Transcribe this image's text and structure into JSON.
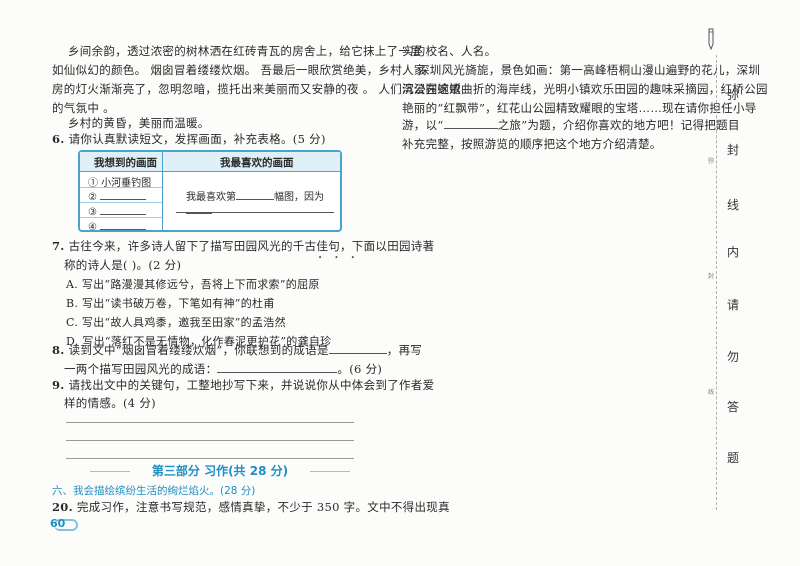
{
  "left": {
    "para1": [
      "乡间余韵，透过浓密的树林洒在红砖青瓦的房舍上，给它抹上了一层",
      "如仙似幻的颜色。 烟囱冒着缕缕炊烟。 吾最后一眼欣赏绝美，乡村人家",
      "房的灯火渐渐亮了，忽明忽暗，揽托出来美丽而又安静的夜 。 人们沉浸在这浓",
      "的气氛中 。"
    ],
    "para2": "乡村的黄昏，美丽而温暖。",
    "q6": {
      "num": "6.",
      "text": "请你认真默读短文，发挥画面，补充表格。(5 分)"
    },
    "table": {
      "col1_header": "我想到的画面",
      "col2_header": "我最喜欢的画面",
      "rows": [
        "① 小河垂钓图",
        "②",
        "③",
        "④"
      ],
      "fav_text_a": "我最喜欢第",
      "fav_text_b": "幅图，因为"
    },
    "q7": {
      "num": "7.",
      "line1": "古往今来，许多诗人留下了描写田园风光的千古佳句，下面以田园诗著",
      "line2": "称的诗人是(        )。(2 分)",
      "options": [
        "A. 写出“路漫漫其修远兮，吾将上下而求索”的屈原",
        "B. 写出“读书破万卷，下笔如有神”的杜甫",
        "C. 写出“故人具鸡黍，邀我至田家”的孟浩然",
        "D. 写出“落红不是无情物，化作春泥更护花”的龚自珍"
      ]
    },
    "q8": {
      "num": "8.",
      "line1a": "读到文中“烟囱冒着缕缕炊烟”，你联想到的成语是",
      "line1b": "，再写",
      "line2a": "一两个描写田园风光的成语：",
      "line2b": "。(6 分)"
    },
    "q9": {
      "num": "9.",
      "line1": "请找出文中的关键句，工整地抄写下来，并说说你从中体会到了作者爱",
      "line2": "样的情感。(4 分)"
    },
    "section_title": "第三部分    习作(共 28 分)",
    "subsection": "六、我会描绘缤纷生活的绚烂焰火。(28 分)",
    "q20": {
      "num": "20.",
      "text": "完成习作，注意书写规范，感情真挚，不少于 350 字。文中不得出现真"
    },
    "page_number": "60"
  },
  "right": {
    "line1": "实的校名、人名。",
    "para": [
      "深圳风光旖旎，景色如画：第一高峰梧桐山漫山遍野的花儿，深圳",
      "湾公园蜿蜒曲折的海岸线，光明小镇欢乐田园的趣味采摘园，红桥公园",
      "艳丽的“红飘带”，红花山公园精致耀眼的宝塔……现在请你担任小导",
      "游，以“"
    ],
    "para_tail_a": "之旅”为题，介绍你喜欢的地方吧！记得把题目",
    "para_last": "补充完整，按照游览的顺序把这个地方介绍清楚。"
  },
  "binding": {
    "chars": [
      "弥",
      "封",
      "线",
      "内",
      "请",
      "勿",
      "答",
      "题"
    ],
    "tiny": [
      "弥",
      "封",
      "线"
    ]
  }
}
